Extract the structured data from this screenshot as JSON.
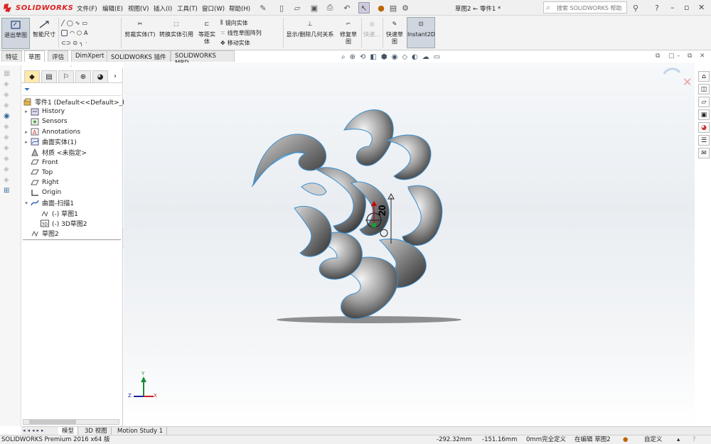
{
  "app": {
    "name": "SOLIDWORKS",
    "document_title": "草图2 ← 零件1 *",
    "search_placeholder": "搜索 SOLIDWORKS 帮助"
  },
  "menu": [
    "文件(F)",
    "编辑(E)",
    "视图(V)",
    "插入(I)",
    "工具(T)",
    "窗口(W)",
    "帮助(H)"
  ],
  "ribbon": {
    "exit_sketch": "退出草图",
    "smart_dimension": "智能尺寸",
    "trim_entities": "剪裁实体(T)",
    "convert_entities": "转换实体引用",
    "offset_line1": "等距实",
    "offset_line2": "体",
    "mirror_entities": "镜向实体",
    "linear_pattern": "线性草图阵列",
    "move_entities": "移动实体",
    "show_relations": "显示/删除几何关系",
    "repair_line1": "修复草",
    "repair_line2": "图",
    "quick_snaps_disabled": "快速...",
    "rapid_sketch_line1": "快速草",
    "rapid_sketch_line2": "图",
    "instant2d": "Instant2D"
  },
  "tabs": [
    "特征",
    "草图",
    "评估",
    "DimXpert",
    "SOLIDWORKS 插件",
    "SOLIDWORKS MBD"
  ],
  "active_tab": "草图",
  "tree": {
    "root": "零件1  (Default<<Default>_Ph",
    "items": [
      {
        "label": "History",
        "icon": "history-icon",
        "expandable": true
      },
      {
        "label": "Sensors",
        "icon": "sensor-icon",
        "expandable": false
      },
      {
        "label": "Annotations",
        "icon": "annotation-icon",
        "expandable": true
      },
      {
        "label": "曲面实体(1)",
        "icon": "surface-bodies-icon",
        "expandable": true
      },
      {
        "label": "材质 <未指定>",
        "icon": "material-icon",
        "expandable": false
      },
      {
        "label": "Front",
        "icon": "plane-icon",
        "expandable": false
      },
      {
        "label": "Top",
        "icon": "plane-icon",
        "expandable": false
      },
      {
        "label": "Right",
        "icon": "plane-icon",
        "expandable": false
      },
      {
        "label": "Origin",
        "icon": "origin-icon",
        "expandable": false
      },
      {
        "label": "曲面-扫描1",
        "icon": "sweep-surface-icon",
        "expandable": true,
        "expanded": true
      },
      {
        "label": "(-) 草图1",
        "icon": "sketch-icon",
        "child": true
      },
      {
        "label": "(-) 3D草图2",
        "icon": "3d-sketch-icon",
        "child": true
      },
      {
        "label": "草图2",
        "icon": "sketch-icon",
        "expandable": false
      }
    ]
  },
  "viewport": {
    "dimension_label": "20",
    "triad_x": "X",
    "triad_y": "Y",
    "triad_z": "Z"
  },
  "bottom_tabs": [
    "模型",
    "3D 视图",
    "Motion Study 1"
  ],
  "active_bottom_tab": "模型",
  "status": {
    "product": "SOLIDWORKS Premium 2016 x64 版",
    "x": "-292.32mm",
    "y": "-151.16mm",
    "z": "0mm",
    "definition": "完全定义",
    "editing": "在编辑 草图2",
    "units": "自定义"
  },
  "colors": {
    "brand_red": "#d22020",
    "accent_blue": "#2a6ebb",
    "surface_edge": "#3a8fd0"
  }
}
